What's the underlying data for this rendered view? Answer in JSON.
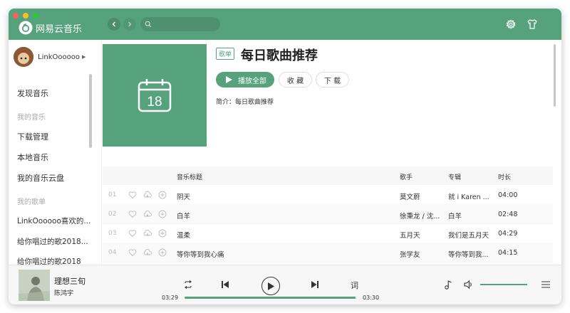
{
  "app": {
    "name": "网易云音乐",
    "brand_color": "#56a27d"
  },
  "header": {
    "search_placeholder": "",
    "icons": [
      "back-icon",
      "forward-icon",
      "search-icon",
      "gear-icon",
      "shirt-icon"
    ]
  },
  "sidebar": {
    "username": "LinkOooooo",
    "items": [
      {
        "label": "发现音乐"
      },
      {
        "label": "我的音乐",
        "section": true
      },
      {
        "label": "下载管理"
      },
      {
        "label": "本地音乐"
      },
      {
        "label": "我的音乐云盘"
      },
      {
        "label": "我的歌单",
        "section": true
      },
      {
        "label": "LinkOooooo喜欢的..."
      },
      {
        "label": "给你唱过的歌2018..."
      },
      {
        "label": "给你唱过的歌2018"
      }
    ]
  },
  "playlist": {
    "tag": "歌单",
    "title": "每日歌曲推荐",
    "play_all": "播放全部",
    "favorite": "收 藏",
    "download": "下 载",
    "intro_label": "简介：",
    "intro_text": "每日歌曲推荐",
    "cover_day": "18"
  },
  "table": {
    "headers": {
      "title": "音乐标题",
      "artist": "歌手",
      "album": "专辑",
      "duration": "时长"
    },
    "rows": [
      {
        "index": "01",
        "title": "阴天",
        "artist": "莫文蔚",
        "album": "就 i Karen ...",
        "duration": "04:00"
      },
      {
        "index": "02",
        "title": "白羊",
        "artist": "徐秉龙 / 沈...",
        "album": "白羊",
        "duration": "02:48"
      },
      {
        "index": "03",
        "title": "温柔",
        "artist": "五月天",
        "album": "我们是五月天",
        "duration": "04:29"
      },
      {
        "index": "04",
        "title": "等你等到我心痛",
        "artist": "张学友",
        "album": "等你等到我...",
        "duration": "04:15"
      }
    ]
  },
  "player": {
    "song": "理想三旬",
    "artist": "陈鸿宇",
    "current_time": "03:29",
    "total_time": "03:30",
    "progress": 0.99,
    "volume": 1.0,
    "lyric_label": "词"
  }
}
